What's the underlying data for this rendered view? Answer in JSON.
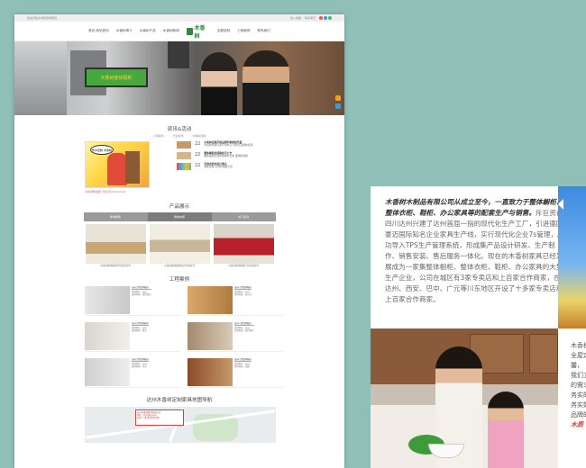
{
  "topbar": {
    "left": "欢迎光临木香树定制家具",
    "right1": "加入收藏",
    "right2": "联系我们"
  },
  "nav": {
    "items": [
      "首页 网站首页",
      "木香树简介",
      "木香树产品",
      "木香树新闻",
      "全屋定制",
      "工程案例",
      "联系我们"
    ],
    "logo_text": "木香树"
  },
  "banner": {
    "sign_text": "木香树整体橱柜"
  },
  "news": {
    "title": "资讯&活动",
    "tabs": [
      "公司新闻",
      "行业资讯",
      "木香树活动"
    ],
    "bubble": "整木定制 木香树",
    "items": [
      {
        "day": "22",
        "title": "木香树全屋定制品牌形象焕新升级",
        "desc": "木香树坚持以客户为中心 为您打造整体家居"
      },
      {
        "day": "22",
        "title": "整体橱柜的选购技巧大全",
        "desc": "橱柜是厨房装修的重中之重 选购需谨慎"
      },
      {
        "day": "22",
        "title": "定制衣柜的设计要点",
        "desc": "衣柜定制 空间利用最大化"
      }
    ],
    "caption": "木香树整体橱柜 全屋定制 2016-04-22"
  },
  "products": {
    "title": "产品展示",
    "tabs": [
      "整体橱柜",
      "整体衣柜",
      "木门系列"
    ],
    "items": [
      {
        "caption": "木香树整体橱柜现代简约系列"
      },
      {
        "caption": "木香树整体橱柜欧式风格系列"
      },
      {
        "caption": "木香树整体橱柜红色烤漆系列"
      }
    ]
  },
  "cases": {
    "title": "工程案例",
    "items": [
      {
        "name": "达州工程案例展示",
        "desc": "案例地址：达州\n案例风格：现代简约"
      },
      {
        "name": "达州工程案例展示",
        "desc": "案例地址：达州\n案例风格：新中式"
      },
      {
        "name": "达州工程案例展示",
        "desc": "案例地址：达州\n案例风格：欧式"
      },
      {
        "name": "达州工程案例展示",
        "desc": "案例地址：达州\n案例风格：现代简约"
      },
      {
        "name": "达州工程案例展示",
        "desc": "案例地址：达州\n案例风格：美式"
      },
      {
        "name": "达州工程案例展示",
        "desc": "案例地址：达州\n案例风格：北欧"
      }
    ]
  },
  "map": {
    "title": "达州木香树定制家具地图导航",
    "popup": "达州木香树家具有限公司\n地址：四川省达州市\n电话：0818-0000000"
  },
  "panel": {
    "lead": "木香树木制品有限公司从成立至今，一直致力于整体橱柜、整体衣柜、鞋柜、办公家具等的配套生产与销售。",
    "body": "斥巨资在四川达州兴建了达州首屈一指的现代化生产工厂，引进德国豪迈国际知名企业家具生产线，实行现代化企业7s管理，成功导入TPS生产管理系统，形成集产品设计研发、生产制作、销售安装、售后服务一体化。现在的木香树家具已经发展成为一家集整体橱柜、整体衣柜、鞋柜、办公家具的大型生产企业，公司在城区有3家专卖店和上百家合作商家，在达州、西安、巴中、广元等川东地区开设了十多家专卖店和上百家合作商家。",
    "right_lines": [
      "木香树",
      "全屋定",
      "馨，",
      "我们立",
      "的需求",
      "务实的",
      "务实好",
      "品牌的",
      "木质"
    ]
  },
  "colors": {
    "accent": "#f0a020",
    "green": "#2b8a3e",
    "background": "#8fbfb6"
  }
}
